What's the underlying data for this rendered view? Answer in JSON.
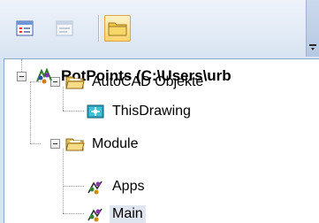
{
  "toolbar": {
    "buttons": [
      {
        "name": "view-object-button",
        "icon": "object-view-icon",
        "active": false
      },
      {
        "name": "view-code-button",
        "icon": "code-view-icon",
        "active": false
      },
      {
        "name": "toggle-folders-button",
        "icon": "folder-icon",
        "active": true
      }
    ]
  },
  "tree": {
    "project_label": "RotPoints (C:\\Users\\urb",
    "folder_objects_label": "AutoCAD Objekte",
    "this_drawing_label": "ThisDrawing",
    "folder_modules_label": "Module",
    "module_apps_label": "Apps",
    "module_main_label": "Main"
  },
  "colors": {
    "selection": "#dfe6ef",
    "toolbar_bg": "#d9e4f2",
    "active_button": "#ffd36b"
  }
}
